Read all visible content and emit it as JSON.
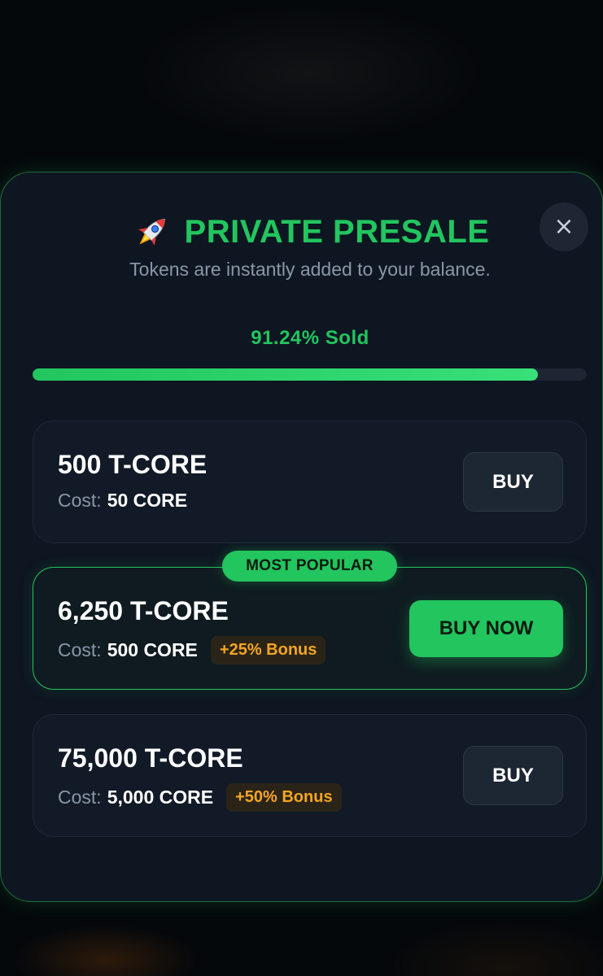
{
  "header": {
    "title": "PRIVATE PRESALE",
    "subtitle": "Tokens are instantly added to your balance.",
    "close_icon": "×"
  },
  "progress": {
    "label": "91.24% Sold",
    "percent": 91.24
  },
  "packages": [
    {
      "amount": "500 T-CORE",
      "cost_label": "Cost:",
      "cost_value": "50 CORE",
      "bonus": "",
      "button": "BUY"
    },
    {
      "badge": "MOST POPULAR",
      "amount": "6,250 T-CORE",
      "cost_label": "Cost:",
      "cost_value": "500 CORE",
      "bonus": "+25% Bonus",
      "button": "BUY NOW"
    },
    {
      "amount": "75,000 T-CORE",
      "cost_label": "Cost:",
      "cost_value": "5,000 CORE",
      "bonus": "+50% Bonus",
      "button": "BUY"
    }
  ],
  "colors": {
    "accent": "#22c55e",
    "bonus": "#f5a524",
    "background": "#0e1621"
  },
  "icons": {
    "title_icon": "rocket-icon",
    "close": "close-icon"
  }
}
